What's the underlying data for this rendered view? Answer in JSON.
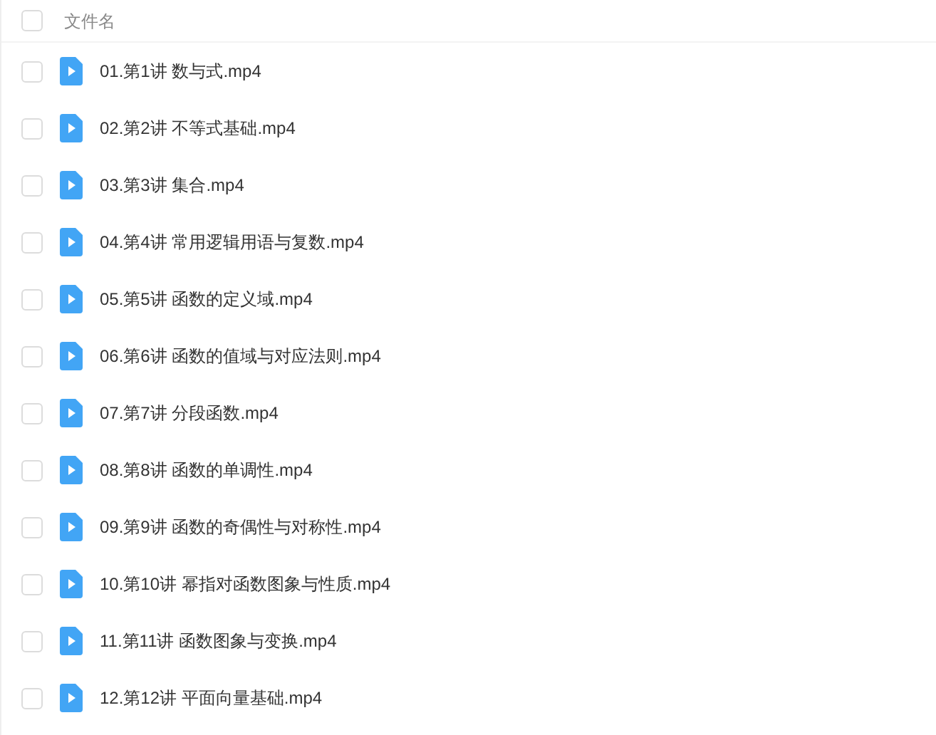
{
  "header": {
    "label": "文件名",
    "checked": false
  },
  "files": [
    {
      "name": "01.第1讲 数与式.mp4",
      "checked": false
    },
    {
      "name": "02.第2讲 不等式基础.mp4",
      "checked": false
    },
    {
      "name": "03.第3讲 集合.mp4",
      "checked": false
    },
    {
      "name": "04.第4讲 常用逻辑用语与复数.mp4",
      "checked": false
    },
    {
      "name": "05.第5讲 函数的定义域.mp4",
      "checked": false
    },
    {
      "name": "06.第6讲 函数的值域与对应法则.mp4",
      "checked": false
    },
    {
      "name": "07.第7讲 分段函数.mp4",
      "checked": false
    },
    {
      "name": "08.第8讲 函数的单调性.mp4",
      "checked": false
    },
    {
      "name": "09.第9讲 函数的奇偶性与对称性.mp4",
      "checked": false
    },
    {
      "name": "10.第10讲 幂指对函数图象与性质.mp4",
      "checked": false
    },
    {
      "name": "11.第11讲 函数图象与变换.mp4",
      "checked": false
    },
    {
      "name": "12.第12讲 平面向量基础.mp4",
      "checked": false
    }
  ]
}
